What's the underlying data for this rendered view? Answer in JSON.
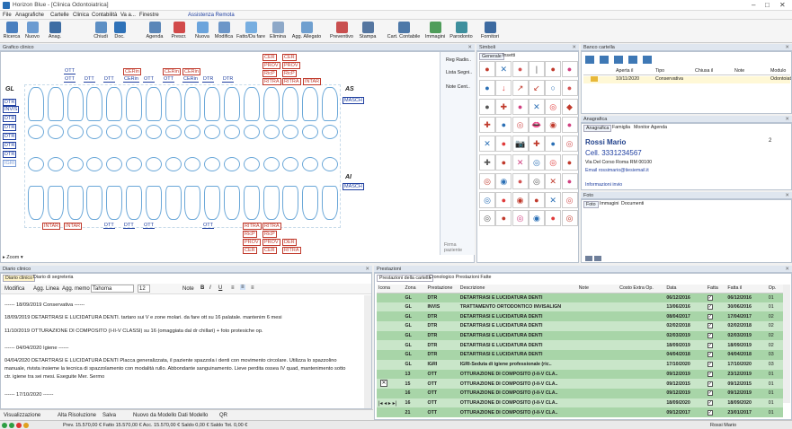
{
  "window": {
    "title": "Horizon Blue - [Clinica Odontoiatrica]"
  },
  "menu": [
    "File",
    "Anagrafiche",
    "Cartelle",
    "Clinica",
    "Contabilità",
    "Va a...",
    "Finestre",
    "Assistenza Remota"
  ],
  "toolbar": [
    "Ricerca",
    "Nuovo",
    "Anag.",
    "Chiudi",
    "Doc.",
    "Agenda",
    "Prescr.",
    "Nuova",
    "Modifica",
    "Fatto/Da fare",
    "Elimina",
    "Agg. Allegato",
    "Preventivo",
    "Stampa",
    "Cart. Contabile",
    "Immagini",
    "Parodonto",
    "Fornitori"
  ],
  "panels": {
    "grafico": "Grafico clinico",
    "simboli": "Simboli",
    "banco": "Banco cartella",
    "anagrafica": "Anagrafica",
    "foto": "Foto",
    "diario": "Diario clinico",
    "prestazioni": "Prestazioni"
  },
  "grafico": {
    "arch_left_upper": "GL",
    "arch_right_upper": "AS",
    "arch_right_lower": "AI",
    "side_labels": [
      "DTR",
      "INVIS",
      "DTR",
      "DTR",
      "DTR",
      "DTR",
      "DTR",
      "IGRI"
    ],
    "masch": "MASCH",
    "right_menu": [
      "Reg Radio..",
      "Lista Segni..",
      "Note Cent..",
      "Firma paziente"
    ],
    "zoom": "Zoom",
    "top_labels": [
      "OTT",
      "OTT",
      "DTT",
      "DTT",
      "CERin",
      "CERin",
      "CERin",
      "CERin",
      "OTT",
      "OTT",
      "CERin",
      "DTR",
      "DTR",
      "CER",
      "CER",
      "PROV",
      "PROV",
      "RicP",
      "RicP",
      "RITRA",
      "RITRA",
      "INTAR"
    ],
    "bottom_labels": [
      "INTAR",
      "INTAR",
      "DTT",
      "DTT",
      "OTT",
      "OTT",
      "RITRA",
      "RITRA",
      "RicP",
      "RicP",
      "PROV",
      "PROV",
      "CER",
      "CER",
      "RITRA",
      "DER"
    ]
  },
  "simboli": {
    "tabs": [
      "Generale",
      "Insetti"
    ],
    "symbols": [
      "●",
      "✕",
      "●",
      "|",
      "●",
      "●",
      "●",
      "↓",
      "↗",
      "↙",
      "○",
      "●",
      "●",
      "✚",
      "●",
      "✕",
      "◎",
      "◆",
      "✚",
      "●",
      "◎",
      "👄",
      "◉",
      "●",
      "✕",
      "●",
      "📷",
      "✚",
      "●",
      "◎",
      "✚",
      "●",
      "✕",
      "◎",
      "◎",
      "●",
      "◎",
      "◉",
      "●",
      "◎",
      "✕",
      "●",
      "◎",
      "●",
      "◉",
      "●",
      "✕",
      "◎",
      "◎",
      "●",
      "◎",
      "◉",
      "●",
      "◎"
    ]
  },
  "banco": {
    "columns": [
      "",
      "Aperta il",
      "Tipo",
      "Chiusa il",
      "Note",
      "Modulo"
    ],
    "row": {
      "opened": "10/11/2020",
      "type": "Conservativa",
      "module": "Odontoiat"
    }
  },
  "anagrafica": {
    "tabs": [
      "Anagrafica",
      "Famiglia",
      "Monitor Agenda"
    ],
    "name": "Rossi Mario",
    "cell": "Cell. 3331234567",
    "address": "Via Del Corso Roma RM 00100",
    "email": "Email rossimario@tiesiemail.it",
    "info": "Informazioni invio",
    "count": "2"
  },
  "foto": {
    "tabs": [
      "Foto",
      "Immagini",
      "Documenti"
    ]
  },
  "diario": {
    "tabs": [
      "Diario clinico",
      "Diario di segreteria"
    ],
    "tools": [
      "Modifica",
      "Agg. Linea",
      "Agg. memo",
      "Tahoma",
      "12",
      "Note"
    ],
    "lines": [
      "------ 18/09/2019 Conservativa ------",
      "18/09/2019     DETARTRASI E LUCIDATURA DENTI. tartaro sui V e zone molari. da fare ott su 16 palatale. mantenim 6 mesi",
      "11/10/2019     OTTURAZIONE DI COMPOSITO (I-II-V CLASSI) su 16 (omaggiata dal dr chillari)   +  foto protesiche  op.",
      "------ 04/04/2020 Igiene ------",
      "04/04/2020     DETARTRASI E LUCIDATURA DENTI Placca generalizzata, il paziente spazzola i denti con movimento circolare. Utilizza lo spazzolino",
      "manuale, rivista insieme la tecnica di spazzolamento con modalità rullo. Abbondante sanguinamento. Lieve perdita ossea IV quad, mantenimento sotto",
      "ctr. igiene tra sei mesi. Eseguite Mer. Sermo",
      "------ 17/10/2020 ------"
    ]
  },
  "prestazioni": {
    "tabs": [
      "Prestazioni della cartella",
      "Cronologico Prestazioni Fatte"
    ],
    "columns": [
      "Icona",
      "Zona",
      "Prestazione",
      "Descrizione",
      "Note",
      "Costo Extra Op.",
      "Data",
      "Fatta",
      "Fatta il",
      "Op."
    ],
    "rows": [
      [
        "",
        "GL",
        "DTR",
        "DETARTRASI E LUCIDATURA DENTI",
        "",
        "",
        "06/12/2016",
        "",
        "06/12/2016",
        "01"
      ],
      [
        "",
        "GL",
        "INVIS",
        "TRATTAMENTO ORTODONTICO INVISALIGN",
        "",
        "",
        "13/06/2016",
        "",
        "30/06/2016",
        "01"
      ],
      [
        "",
        "GL",
        "DTR",
        "DETARTRASI E LUCIDATURA DENTI",
        "",
        "",
        "08/04/2017",
        "",
        "17/04/2017",
        "02"
      ],
      [
        "",
        "GL",
        "DTR",
        "DETARTRASI E LUCIDATURA DENTI",
        "",
        "",
        "02/02/2018",
        "",
        "02/02/2018",
        "02"
      ],
      [
        "",
        "GL",
        "DTR",
        "DETARTRASI E LUCIDATURA DENTI",
        "",
        "",
        "02/03/2019",
        "",
        "02/03/2019",
        "02"
      ],
      [
        "",
        "GL",
        "DTR",
        "DETARTRASI E LUCIDATURA DENTI",
        "",
        "",
        "18/09/2019",
        "",
        "18/09/2019",
        "02"
      ],
      [
        "",
        "GL",
        "DTR",
        "DETARTRASI E LUCIDATURA DENTI",
        "",
        "",
        "04/04/2018",
        "",
        "04/04/2018",
        "03"
      ],
      [
        "",
        "GL",
        "IGRI",
        "IGRI-Seduta di igiene professionale (ric..",
        "",
        "",
        "17/10/2020",
        "",
        "17/10/2020",
        "03"
      ],
      [
        "",
        "13",
        "OTT",
        "OTTURAZIONE DI COMPOSITO (I-II-V CLA..",
        "",
        "",
        "09/12/2019",
        "",
        "23/12/2019",
        "01"
      ],
      [
        "",
        "15",
        "OTT",
        "OTTURAZIONE DI COMPOSITO (I-II-V CLA..",
        "",
        "",
        "09/12/2015",
        "",
        "09/12/2015",
        "01"
      ],
      [
        "",
        "16",
        "OTT",
        "OTTURAZIONE DI COMPOSITO (I-II-V CLA..",
        "",
        "",
        "09/12/2019",
        "",
        "09/12/2019",
        "01"
      ],
      [
        "",
        "16",
        "OTT",
        "OTTURAZIONE DI COMPOSITO (I-II-V CLA..",
        "",
        "",
        "18/09/2020",
        "",
        "18/09/2020",
        "01"
      ],
      [
        "",
        "21",
        "OTT",
        "OTTURAZIONE DI COMPOSITO (I-II-V CLA..",
        "",
        "",
        "09/12/2017",
        "",
        "23/01/2017",
        "01"
      ]
    ]
  },
  "bottombar": [
    "Visualizzazione",
    "Alta Risoluzione",
    "Salva",
    "Nuovo da Modello",
    "Dati Modello",
    "QR"
  ],
  "status": {
    "text": "Prev. 15.570,00 € Fatto 15.570,00 € Acc. 15.570,00 € Saldo 0,00 € Saldo Tot. 0,00 €",
    "patient": "Rossi Mario"
  }
}
